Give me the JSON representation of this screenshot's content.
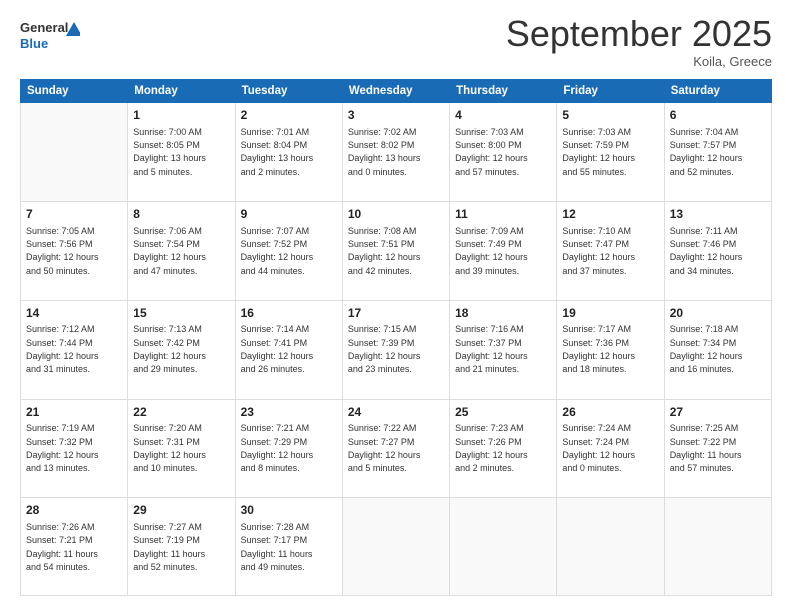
{
  "logo": {
    "line1": "General",
    "line2": "Blue"
  },
  "title": "September 2025",
  "location": "Koila, Greece",
  "days_header": [
    "Sunday",
    "Monday",
    "Tuesday",
    "Wednesday",
    "Thursday",
    "Friday",
    "Saturday"
  ],
  "weeks": [
    [
      {
        "day": "",
        "info": ""
      },
      {
        "day": "1",
        "info": "Sunrise: 7:00 AM\nSunset: 8:05 PM\nDaylight: 13 hours\nand 5 minutes."
      },
      {
        "day": "2",
        "info": "Sunrise: 7:01 AM\nSunset: 8:04 PM\nDaylight: 13 hours\nand 2 minutes."
      },
      {
        "day": "3",
        "info": "Sunrise: 7:02 AM\nSunset: 8:02 PM\nDaylight: 13 hours\nand 0 minutes."
      },
      {
        "day": "4",
        "info": "Sunrise: 7:03 AM\nSunset: 8:00 PM\nDaylight: 12 hours\nand 57 minutes."
      },
      {
        "day": "5",
        "info": "Sunrise: 7:03 AM\nSunset: 7:59 PM\nDaylight: 12 hours\nand 55 minutes."
      },
      {
        "day": "6",
        "info": "Sunrise: 7:04 AM\nSunset: 7:57 PM\nDaylight: 12 hours\nand 52 minutes."
      }
    ],
    [
      {
        "day": "7",
        "info": "Sunrise: 7:05 AM\nSunset: 7:56 PM\nDaylight: 12 hours\nand 50 minutes."
      },
      {
        "day": "8",
        "info": "Sunrise: 7:06 AM\nSunset: 7:54 PM\nDaylight: 12 hours\nand 47 minutes."
      },
      {
        "day": "9",
        "info": "Sunrise: 7:07 AM\nSunset: 7:52 PM\nDaylight: 12 hours\nand 44 minutes."
      },
      {
        "day": "10",
        "info": "Sunrise: 7:08 AM\nSunset: 7:51 PM\nDaylight: 12 hours\nand 42 minutes."
      },
      {
        "day": "11",
        "info": "Sunrise: 7:09 AM\nSunset: 7:49 PM\nDaylight: 12 hours\nand 39 minutes."
      },
      {
        "day": "12",
        "info": "Sunrise: 7:10 AM\nSunset: 7:47 PM\nDaylight: 12 hours\nand 37 minutes."
      },
      {
        "day": "13",
        "info": "Sunrise: 7:11 AM\nSunset: 7:46 PM\nDaylight: 12 hours\nand 34 minutes."
      }
    ],
    [
      {
        "day": "14",
        "info": "Sunrise: 7:12 AM\nSunset: 7:44 PM\nDaylight: 12 hours\nand 31 minutes."
      },
      {
        "day": "15",
        "info": "Sunrise: 7:13 AM\nSunset: 7:42 PM\nDaylight: 12 hours\nand 29 minutes."
      },
      {
        "day": "16",
        "info": "Sunrise: 7:14 AM\nSunset: 7:41 PM\nDaylight: 12 hours\nand 26 minutes."
      },
      {
        "day": "17",
        "info": "Sunrise: 7:15 AM\nSunset: 7:39 PM\nDaylight: 12 hours\nand 23 minutes."
      },
      {
        "day": "18",
        "info": "Sunrise: 7:16 AM\nSunset: 7:37 PM\nDaylight: 12 hours\nand 21 minutes."
      },
      {
        "day": "19",
        "info": "Sunrise: 7:17 AM\nSunset: 7:36 PM\nDaylight: 12 hours\nand 18 minutes."
      },
      {
        "day": "20",
        "info": "Sunrise: 7:18 AM\nSunset: 7:34 PM\nDaylight: 12 hours\nand 16 minutes."
      }
    ],
    [
      {
        "day": "21",
        "info": "Sunrise: 7:19 AM\nSunset: 7:32 PM\nDaylight: 12 hours\nand 13 minutes."
      },
      {
        "day": "22",
        "info": "Sunrise: 7:20 AM\nSunset: 7:31 PM\nDaylight: 12 hours\nand 10 minutes."
      },
      {
        "day": "23",
        "info": "Sunrise: 7:21 AM\nSunset: 7:29 PM\nDaylight: 12 hours\nand 8 minutes."
      },
      {
        "day": "24",
        "info": "Sunrise: 7:22 AM\nSunset: 7:27 PM\nDaylight: 12 hours\nand 5 minutes."
      },
      {
        "day": "25",
        "info": "Sunrise: 7:23 AM\nSunset: 7:26 PM\nDaylight: 12 hours\nand 2 minutes."
      },
      {
        "day": "26",
        "info": "Sunrise: 7:24 AM\nSunset: 7:24 PM\nDaylight: 12 hours\nand 0 minutes."
      },
      {
        "day": "27",
        "info": "Sunrise: 7:25 AM\nSunset: 7:22 PM\nDaylight: 11 hours\nand 57 minutes."
      }
    ],
    [
      {
        "day": "28",
        "info": "Sunrise: 7:26 AM\nSunset: 7:21 PM\nDaylight: 11 hours\nand 54 minutes."
      },
      {
        "day": "29",
        "info": "Sunrise: 7:27 AM\nSunset: 7:19 PM\nDaylight: 11 hours\nand 52 minutes."
      },
      {
        "day": "30",
        "info": "Sunrise: 7:28 AM\nSunset: 7:17 PM\nDaylight: 11 hours\nand 49 minutes."
      },
      {
        "day": "",
        "info": ""
      },
      {
        "day": "",
        "info": ""
      },
      {
        "day": "",
        "info": ""
      },
      {
        "day": "",
        "info": ""
      }
    ]
  ]
}
